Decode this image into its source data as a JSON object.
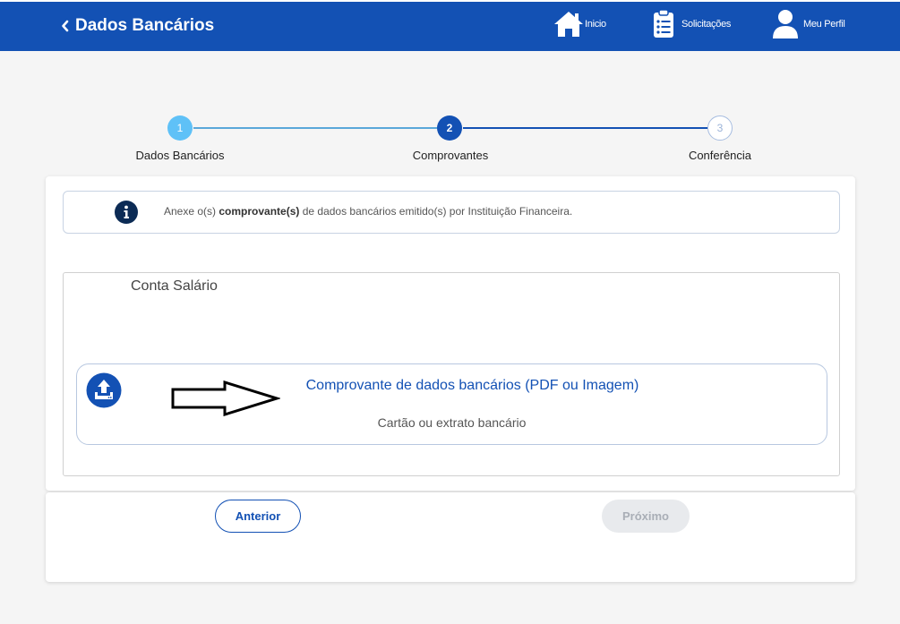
{
  "header": {
    "title": "Dados Bancários",
    "nav": [
      {
        "label": "Inicio",
        "icon": "home-icon"
      },
      {
        "label": "Solicitações",
        "icon": "clipboard-list-icon"
      },
      {
        "label": "Meu Perfil",
        "icon": "user-icon"
      }
    ],
    "bg_color": "#1351b4"
  },
  "stepper": {
    "steps": [
      {
        "number": "1",
        "label": "Dados Bancários",
        "state": "done"
      },
      {
        "number": "2",
        "label": "Comprovantes",
        "state": "current"
      },
      {
        "number": "3",
        "label": "Conferência",
        "state": "pending"
      }
    ]
  },
  "info": {
    "text_before": "Anexe o(s) ",
    "text_bold": "comprovante(s)",
    "text_after": " de dados bancários emitido(s) por Instituição Financeira."
  },
  "section": {
    "title": "Conta Salário",
    "upload": {
      "title": "Comprovante de dados bancários (PDF ou Imagem)",
      "subtitle": "Cartão ou extrato bancário"
    }
  },
  "footer": {
    "prev_label": "Anterior",
    "next_label": "Próximo",
    "next_disabled": true
  }
}
